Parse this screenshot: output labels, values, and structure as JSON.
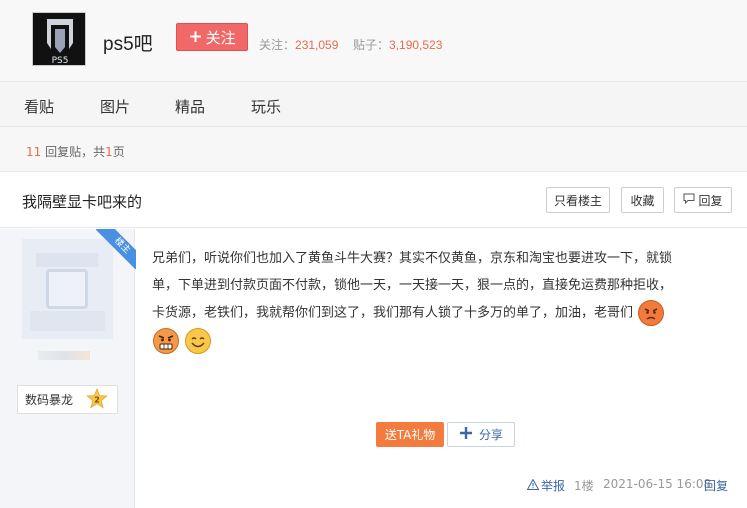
{
  "forum": {
    "name": "ps5吧",
    "logo_text": "PS5",
    "follow_label": "关注",
    "followers_label": "关注：",
    "followers": "231,059",
    "posts_label": "贴子：",
    "posts": "3,190,523"
  },
  "tabs": [
    "看贴",
    "图片",
    "精品",
    "玩乐"
  ],
  "reply_info": {
    "count": "11",
    "count_suffix": " 回复贴，共",
    "pages": "1",
    "pages_suffix": "页"
  },
  "thread": {
    "title": "我隔壁显卡吧来的",
    "only_op_label": "只看楼主",
    "favorite_label": "收藏",
    "reply_label": "回复"
  },
  "post": {
    "badge": "楼主",
    "username": "数码暴龙",
    "level": "2",
    "content_lines": [
      "兄弟们，听说你们也加入了黄鱼斗牛大赛？其实不仅黄鱼，京东和淘宝也要进攻一下，就锁",
      "单，下单进到付款页面不付款，锁他一天，一天接一天，狠一点的，直接免运费那种拒收，",
      "卡货源，老铁们，我就帮你们到这了，我们那有人锁了十多万的单了，加油，老哥们"
    ],
    "gift_label": "送TA礼物",
    "share_label": "分享",
    "report_label": "举报",
    "floor": "1楼",
    "time": "2021-06-15 16:08",
    "reply_label": "回复"
  },
  "colors": {
    "accent_red": "#f16868",
    "count_red": "#e96a4f",
    "link_blue": "#3a67a8",
    "gift_orange": "#f37b3e",
    "badge_blue": "#4a90e2"
  }
}
